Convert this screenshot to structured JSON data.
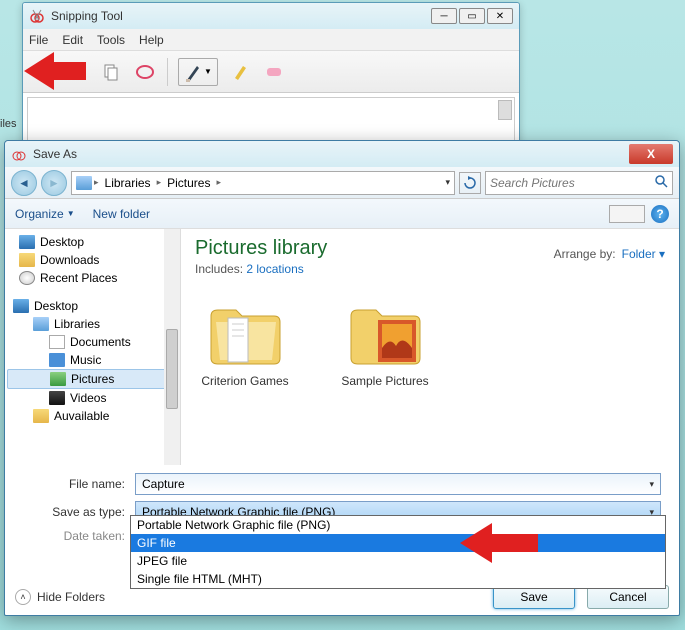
{
  "side_label": "iles",
  "snipping": {
    "title": "Snipping Tool",
    "menu": [
      "File",
      "Edit",
      "Tools",
      "Help"
    ],
    "icons": {
      "new": "new-snip-icon",
      "save": "save-icon",
      "copy": "copy-icon",
      "send": "send-icon",
      "pen": "pen-icon",
      "highlighter": "highlighter-icon",
      "eraser": "eraser-icon"
    }
  },
  "saveAs": {
    "title": "Save As",
    "breadcrumb": [
      "Libraries",
      "Pictures"
    ],
    "search_placeholder": "Search Pictures",
    "toolbar": {
      "organize": "Organize",
      "newfolder": "New folder"
    },
    "tree": {
      "desktop1": "Desktop",
      "downloads": "Downloads",
      "recent": "Recent Places",
      "desktop2": "Desktop",
      "libraries": "Libraries",
      "documents": "Documents",
      "music": "Music",
      "pictures": "Pictures",
      "videos": "Videos",
      "auvailable": "Auvailable"
    },
    "library": {
      "title": "Pictures library",
      "includes_label": "Includes:",
      "includes_link": "2 locations",
      "arrange_label": "Arrange by:",
      "arrange_value": "Folder"
    },
    "folders": [
      {
        "name": "Criterion Games"
      },
      {
        "name": "Sample Pictures"
      }
    ],
    "form": {
      "filename_label": "File name:",
      "filename_value": "Capture",
      "type_label": "Save as type:",
      "type_value": "Portable Network Graphic file (PNG)",
      "date_label": "Date taken:"
    },
    "type_options": [
      "Portable Network Graphic file (PNG)",
      "GIF file",
      "JPEG file",
      "Single file HTML (MHT)"
    ],
    "selected_type_index": 1,
    "footer": {
      "hide": "Hide Folders",
      "save": "Save",
      "cancel": "Cancel"
    }
  }
}
